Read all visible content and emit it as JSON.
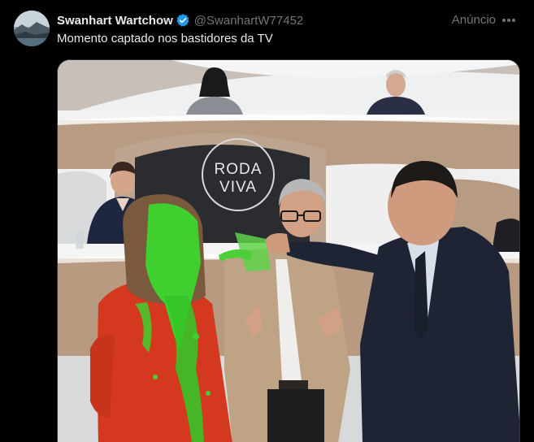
{
  "post": {
    "author": {
      "display_name": "Swanhart Wartchow",
      "handle": "@SwanhartW77452",
      "verified": true,
      "avatar_icon": "landscape-avatar"
    },
    "ad_label": "Anúncio",
    "more_icon": "more-horizontal-icon",
    "text": "Momento captado nos bastidores da TV",
    "media": {
      "logo_line1": "RODA",
      "logo_line2": "VIVA"
    }
  },
  "colors": {
    "background": "#000000",
    "primary_text": "#e7e9ea",
    "secondary_text": "#71767b",
    "verified_blue": "#1d9bf0"
  }
}
